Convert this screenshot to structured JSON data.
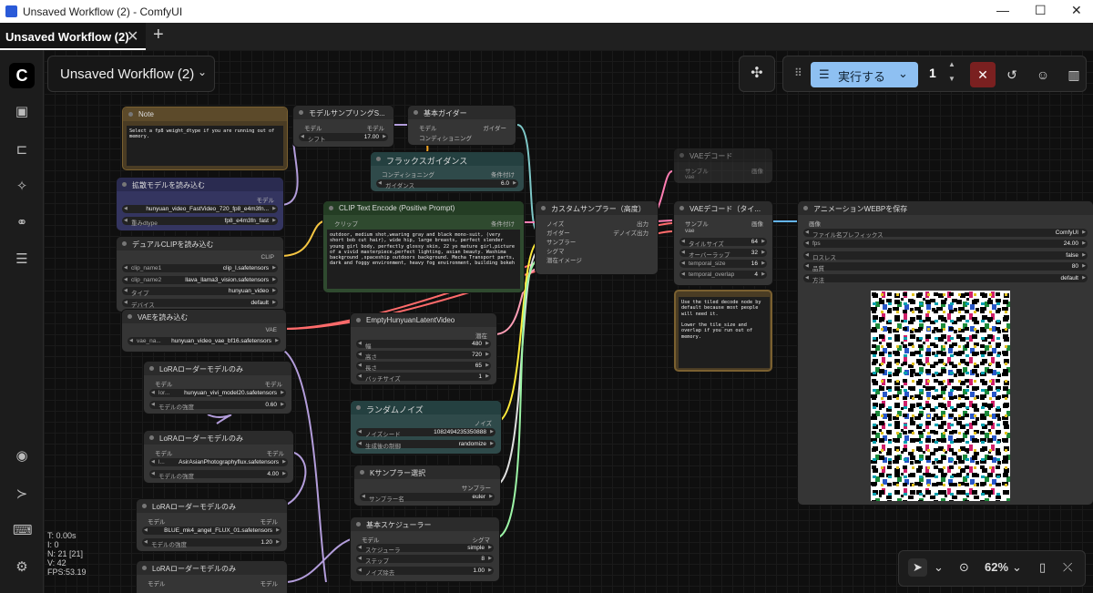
{
  "window": {
    "title": "Unsaved Workflow (2) - ComfyUI",
    "min": "—",
    "max": "☐",
    "close": "✕"
  },
  "tab": {
    "label": "Unsaved Workflow (2)",
    "close": "✕",
    "add": "+"
  },
  "workflow_title": "Unsaved Workflow (2)",
  "toolbar": {
    "run_label": "実行する",
    "run_count": "1",
    "cancel": "✕"
  },
  "stats": {
    "t": "T: 0.00s",
    "i": "I: 0",
    "n": "N: 21 [21]",
    "v": "V: 42",
    "fps": "FPS:53.19"
  },
  "zoom": "62%",
  "nodes": {
    "note": {
      "title": "Note",
      "text": "Select a fp8 weight_dtype if you are running out of memory."
    },
    "model_sampling": {
      "title": "モデルサンプリングS...",
      "in": "モデル",
      "out": "モデル",
      "w1_label": "シフト",
      "w1_value": "17.00"
    },
    "basic_guider": {
      "title": "基本ガイダー",
      "in1": "モデル",
      "in2": "コンディショニング",
      "out": "ガイダー"
    },
    "flux_guidance": {
      "title": "フラックスガイダンス",
      "in": "コンディショニング",
      "out": "条件付け",
      "w1_label": "ガイダンス",
      "w1_value": "6.0"
    },
    "load_diffusion": {
      "title": "拡散モデルを読み込む",
      "out": "モデル",
      "w1_label": "",
      "w1_value": "hunyuan_video_FastVideo_720_fp8_e4m3fn...",
      "w2_label": "重みdtype",
      "w2_value": "fp8_e4m3fn_fast"
    },
    "dual_clip": {
      "title": "デュアルCLIPを読み込む",
      "out": "CLIP",
      "w1_label": "clip_name1",
      "w1_value": "clip_l.safetensors",
      "w2_label": "clip_name2",
      "w2_value": "llava_llama3_vision.safetensors",
      "w3_label": "タイプ",
      "w3_value": "hunyuan_video",
      "w4_label": "デバイス",
      "w4_value": "default"
    },
    "clip_text": {
      "title": "CLIP Text Encode (Positive Prompt)",
      "in": "クリップ",
      "out": "条件付け",
      "text": "outdoor, medium shot,wearing gray and black mono-suit, (very short bob cut hair), wide hip, large breasts, perfect slender young girl body, perfectly glossy skin, 22 yo mature girl,picture of a vivid masterpiece,perfect lighting, asian beauty. Washima background ,spaceship outdoors background. Mecha Transport parts, dark and foggy environment, heavy fog environment, building bokeh"
    },
    "custom_sampler": {
      "title": "カスタムサンプラー（高度）",
      "in1": "ノイズ",
      "in2": "ガイダー",
      "in3": "サンプラー",
      "in4": "シグマ",
      "in5": "潜在イメージ",
      "out1": "出力",
      "out2": "デノイズ出力"
    },
    "vae_decode_top": {
      "title": "VAEデコード",
      "in1": "サンプル",
      "in2": "vae",
      "out": "画像"
    },
    "vae_decode_tiled": {
      "title": "VAEデコード（タイ...",
      "in1": "サンプル",
      "in2": "vae",
      "out": "画像",
      "w1_label": "タイルサイズ",
      "w1_value": "64",
      "w2_label": "オーバーラップ",
      "w2_value": "32",
      "w3_label": "temporal_size",
      "w3_value": "16",
      "w4_label": "temporal_overlap",
      "w4_value": "4"
    },
    "note2": {
      "text": "Use the tiled decode node by default because most people will need it.\n\nLower the tile_size and overlap if you run out of memory."
    },
    "save_webp": {
      "title": "アニメーションWEBPを保存",
      "in": "画像",
      "w1_label": "ファイル名プレフィックス",
      "w1_value": "ComfyUI",
      "w2_label": "fps",
      "w2_value": "24.00",
      "w3_label": "ロスレス",
      "w3_value": "false",
      "w4_label": "品質",
      "w4_value": "80",
      "w5_label": "方法",
      "w5_value": "default"
    },
    "vae_loader": {
      "title": "VAEを読み込む",
      "out": "VAE",
      "w1_label": "vae_na...",
      "w1_value": "hunyuan_video_vae_bf16.safetensors"
    },
    "empty_latent": {
      "title": "EmptyHunyuanLatentVideo",
      "out": "潜在",
      "w1_label": "幅",
      "w1_value": "480",
      "w2_label": "高さ",
      "w2_value": "720",
      "w3_label": "長さ",
      "w3_value": "65",
      "w4_label": "バッチサイズ",
      "w4_value": "1"
    },
    "lora1": {
      "title": "LoRAローダーモデルのみ",
      "in": "モデル",
      "out": "モデル",
      "w1_label": "lor...",
      "w1_value": "hunyuan_vivi_model20.safetensors",
      "w2_label": "モデルの強度",
      "w2_value": "0.60"
    },
    "lora2": {
      "title": "LoRAローダーモデルのみ",
      "in": "モデル",
      "out": "モデル",
      "w1_label": "l...",
      "w1_value": "AsirAsianPhotographyflux.safetensors",
      "w2_label": "モデルの強度",
      "w2_value": "4.00"
    },
    "lora3": {
      "title": "LoRAローダーモデルのみ",
      "in": "モデル",
      "out": "モデル",
      "w1_label": "",
      "w1_value": "BLUE_mk4_angel_FLUX_01.safetensors",
      "w2_label": "モデルの強度",
      "w2_value": "1.20"
    },
    "lora4": {
      "title": "LoRAローダーモデルのみ",
      "in": "モデル",
      "out": "モデル"
    },
    "random_noise": {
      "title": "ランダムノイズ",
      "out": "ノイズ",
      "w1_label": "ノイズシード",
      "w1_value": "1082494235350888",
      "w2_label": "生成後の制御",
      "w2_value": "randomize"
    },
    "ksampler_select": {
      "title": "Kサンプラー選択",
      "out": "サンプラー",
      "w1_label": "サンプラー名",
      "w1_value": "euler"
    },
    "basic_scheduler": {
      "title": "基本スケジューラー",
      "in": "モデル",
      "out": "シグマ",
      "w1_label": "スケジューラ",
      "w1_value": "simple",
      "w2_label": "ステップ",
      "w2_value": "8",
      "w3_label": "ノイズ除去",
      "w3_value": "1.00"
    }
  }
}
